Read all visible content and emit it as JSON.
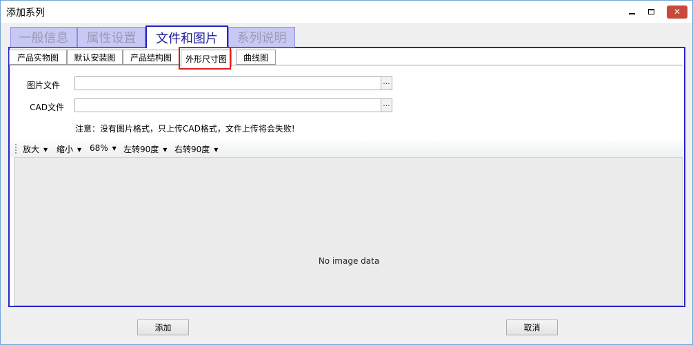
{
  "window": {
    "title": "添加系列",
    "controls": {
      "minimize": "minimize-icon",
      "maximize": "maximize-icon",
      "close": "close-icon"
    }
  },
  "main_tabs": [
    {
      "label": "一般信息",
      "active": false
    },
    {
      "label": "属性设置",
      "active": false
    },
    {
      "label": "文件和图片",
      "active": true
    },
    {
      "label": "系列说明",
      "active": false
    }
  ],
  "sub_tabs": [
    {
      "label": "产品实物图",
      "active": false
    },
    {
      "label": "默认安装图",
      "active": false
    },
    {
      "label": "产品结构图",
      "active": false
    },
    {
      "label": "外形尺寸图",
      "active": true
    },
    {
      "label": "曲线图",
      "active": false
    }
  ],
  "form": {
    "image_file_label": "图片文件",
    "image_file_value": "",
    "cad_file_label": "CAD文件",
    "cad_file_value": "",
    "browse_label": "···",
    "note": "注意：没有图片格式，只上传CAD格式，文件上传将会失败!"
  },
  "toolbar": {
    "zoom_in": "放大",
    "zoom_out": "缩小",
    "zoom_level": "68%",
    "rotate_left": "左转90度",
    "rotate_right": "右转90度"
  },
  "viewer": {
    "empty_text": "No image data"
  },
  "buttons": {
    "add": "添加",
    "cancel": "取消"
  },
  "colors": {
    "accent_border": "#2424c8",
    "highlight": "#e01b1b",
    "close_button": "#c84a3c"
  }
}
